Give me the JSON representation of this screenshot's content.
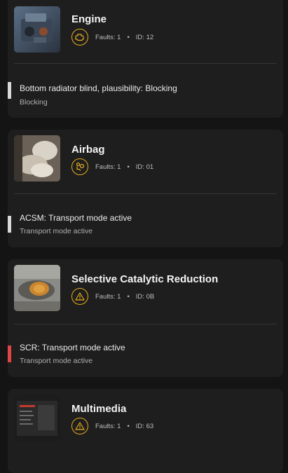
{
  "labels": {
    "faults_prefix": "Faults:",
    "id_prefix": "ID:",
    "separator": "•"
  },
  "colors": {
    "accent": "#e6ad1e",
    "severity_low": "#d8d8d8",
    "severity_high": "#e04646"
  },
  "modules": [
    {
      "name": "Engine",
      "icon": "engine-warning-icon",
      "faults": "1",
      "id": "12",
      "fault_title": "Bottom radiator blind, plausibility: Blocking",
      "fault_status": "Blocking",
      "severity": "low"
    },
    {
      "name": "Airbag",
      "icon": "airbag-icon",
      "faults": "1",
      "id": "01",
      "fault_title": "ACSM: Transport mode active",
      "fault_status": "Transport mode active",
      "severity": "low"
    },
    {
      "name": "Selective Catalytic Reduction",
      "icon": "warning-triangle-icon",
      "faults": "1",
      "id": "0B",
      "fault_title": "SCR: Transport mode active",
      "fault_status": "Transport mode active",
      "severity": "high"
    },
    {
      "name": "Multimedia",
      "icon": "warning-triangle-icon",
      "faults": "1",
      "id": "63"
    }
  ]
}
